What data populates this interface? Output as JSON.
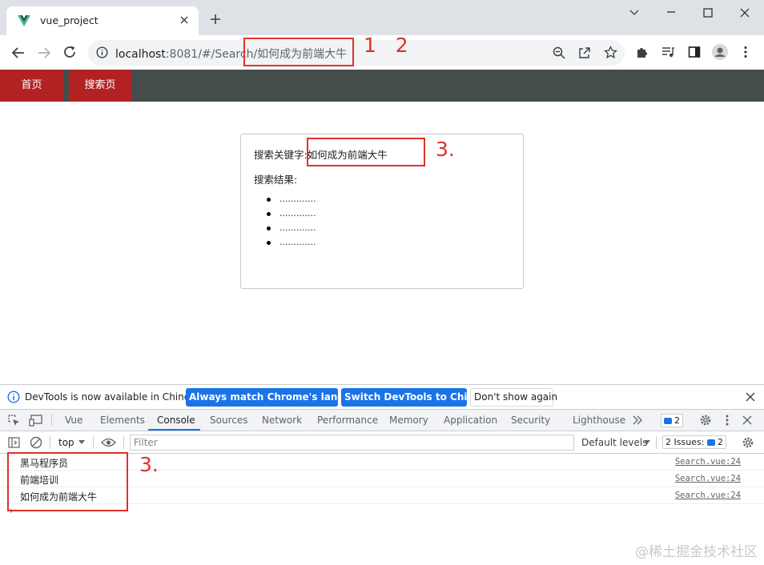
{
  "browser": {
    "tab_title": "vue_project",
    "url_host": "localhost",
    "url_rest": ":8081/#/Search/如何成为前端大牛",
    "brand_color": "#41b883"
  },
  "page": {
    "nav": [
      {
        "label": "首页"
      },
      {
        "label": "搜索页"
      }
    ],
    "keyword_label": "搜索关键字:",
    "keyword_value": "如何成为前端大牛",
    "results_label": "搜索结果:",
    "results": [
      ".............",
      ".............",
      ".............",
      "............."
    ]
  },
  "annotations": {
    "url_marks": "1   2",
    "card_mark": "3.",
    "console_mark": "3.",
    "color": "#e0302a"
  },
  "devtools": {
    "info_message": "DevTools is now available in Chinese!",
    "btn_match": "Always match Chrome's language",
    "btn_switch": "Switch DevTools to Chinese",
    "btn_dismiss": "Don't show again",
    "tabs": [
      "Vue",
      "Elements",
      "Console",
      "Sources",
      "Network",
      "Performance",
      "Memory",
      "Application",
      "Security",
      "Lighthouse"
    ],
    "active_tab": "Console",
    "issues_badge_count": "2",
    "context": "top",
    "filter_placeholder": "Filter",
    "levels": "Default levels",
    "issues_label": "2 Issues:",
    "issues_count": "2",
    "logs": [
      {
        "text": "黑马程序员",
        "source": "Search.vue:24"
      },
      {
        "text": "前端培训",
        "source": "Search.vue:24"
      },
      {
        "text": "如何成为前端大牛",
        "source": "Search.vue:24"
      }
    ],
    "prompt": "›"
  },
  "watermark": "@稀土掘金技术社区"
}
